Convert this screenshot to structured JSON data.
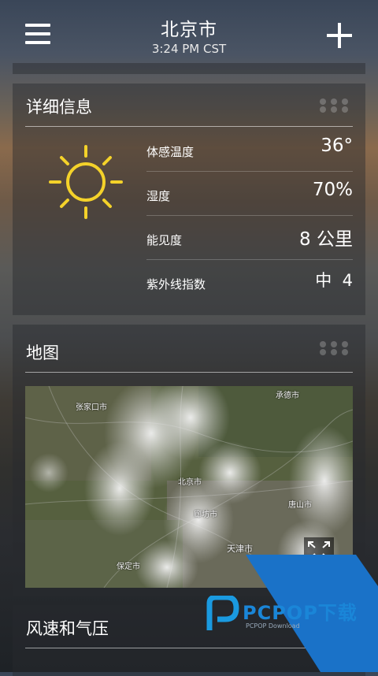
{
  "header": {
    "city": "北京市",
    "time": "3:24 PM CST"
  },
  "details": {
    "title": "详细信息",
    "rows": [
      {
        "label": "体感温度",
        "value": "36°"
      },
      {
        "label": "湿度",
        "value": "70%"
      },
      {
        "label": "能见度",
        "value": "8 公里"
      },
      {
        "label": "紫外线指数",
        "value": "中  4"
      }
    ]
  },
  "map": {
    "title": "地图",
    "labels": [
      "张家口市",
      "承德市",
      "北京市",
      "廊坊市",
      "唐山市",
      "天津市",
      "保定市"
    ]
  },
  "wind": {
    "title": "风速和气压"
  },
  "watermark": {
    "brand": "PCPOP下载",
    "sub": "PCPOP Download"
  },
  "colors": {
    "sun": "#f4d22a",
    "watermark_blue": "#1a72c8"
  }
}
